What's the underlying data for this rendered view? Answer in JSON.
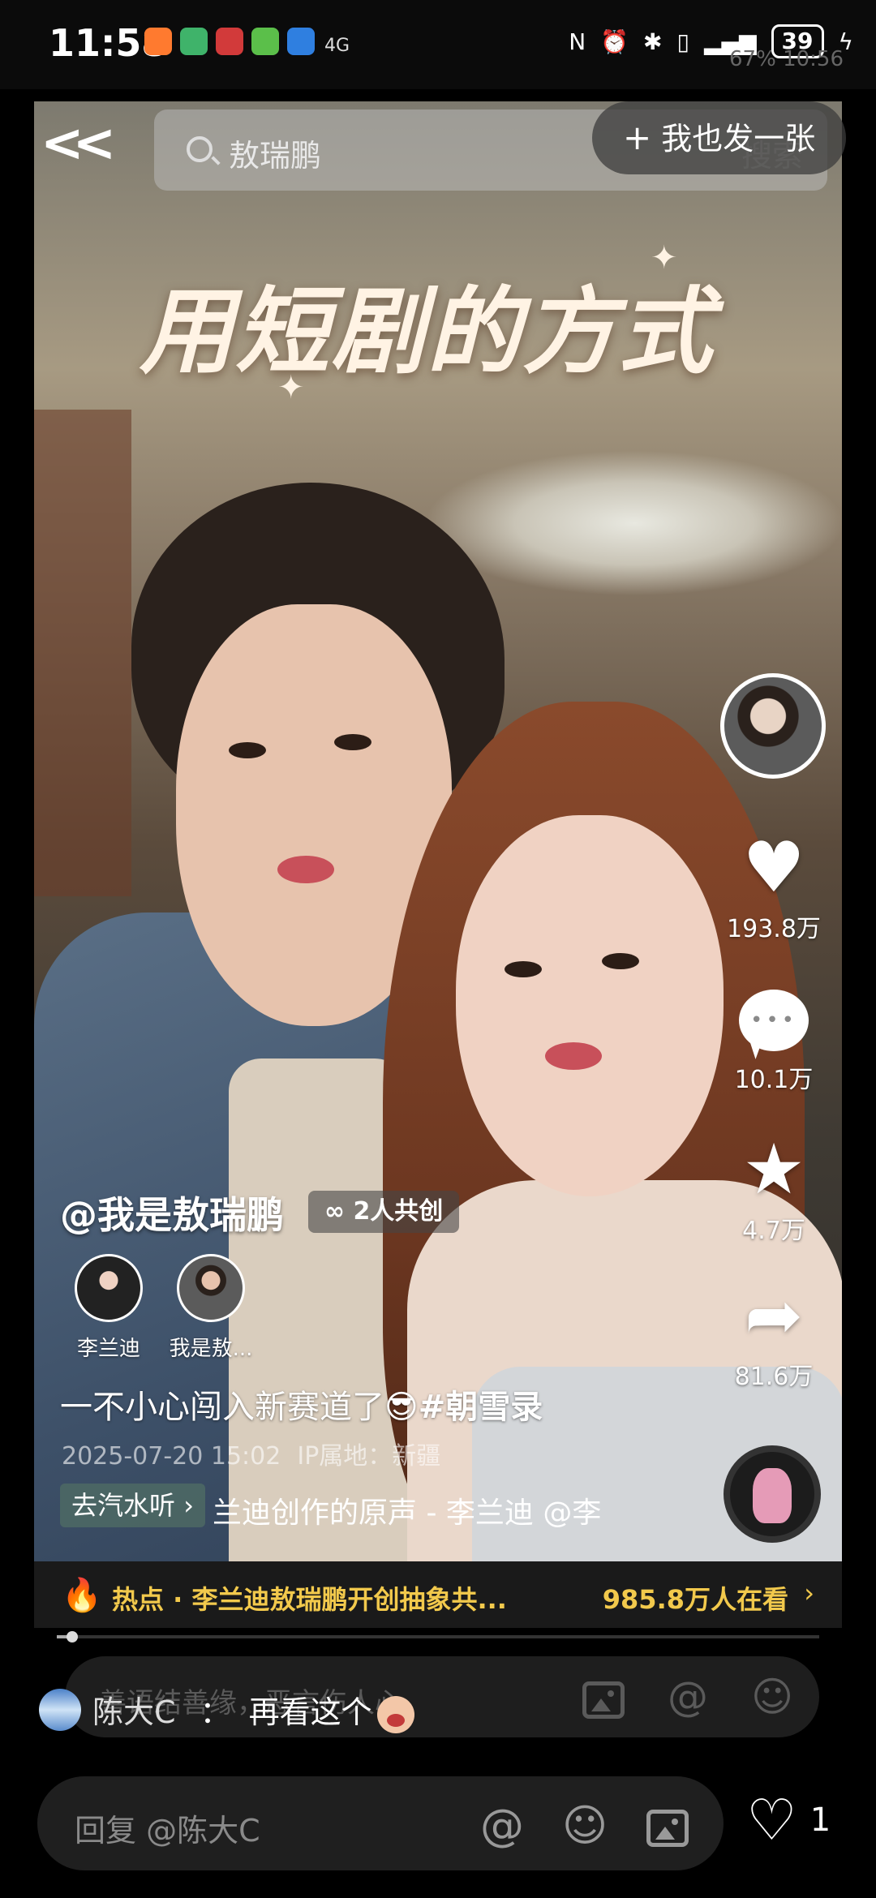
{
  "status_bar": {
    "time": "11:58",
    "signal_label": "4G",
    "battery": "39",
    "ghost_text": "67%  10:56"
  },
  "top_bar": {
    "back_icon": "double-chevron-left-icon",
    "search_text": "敖瑞鹏",
    "search_ghost": "搜索",
    "post_button": "我也发一张"
  },
  "video": {
    "overlay_title": "用短剧的方式"
  },
  "actions": {
    "likes": "193.8万",
    "comments": "10.1万",
    "favorites": "4.7万",
    "shares": "81.6万"
  },
  "info": {
    "author": "@我是敖瑞鹏",
    "cocreate": "2人共创",
    "creators": [
      {
        "name": "李兰迪"
      },
      {
        "name": "我是敖..."
      }
    ],
    "caption_text": "一不小心闯入新赛道了",
    "caption_emoji": "😎",
    "caption_tag": "#朝雪录",
    "date": "2025-07-20 15:02",
    "ip": "IP属地：新疆",
    "soda_tag": "去汽水听",
    "music": "兰迪创作的原声 - 李兰迪   @李"
  },
  "hot": {
    "text": "热点 · 李兰迪敖瑞鹏开创抽象共...",
    "count": "985.8万人在看"
  },
  "progress": {
    "fraction": 0.02
  },
  "video_comment": {
    "placeholder": "善语结善缘，恶言伤人心"
  },
  "overlay_comment": {
    "user": "陈大C",
    "separator": "：",
    "text": "再看这个"
  },
  "reply": {
    "placeholder": "回复 @陈大C",
    "like_count": "1"
  },
  "colors": {
    "hot_text": "#f2c94c",
    "hot_icon": "#ff5a1f"
  }
}
